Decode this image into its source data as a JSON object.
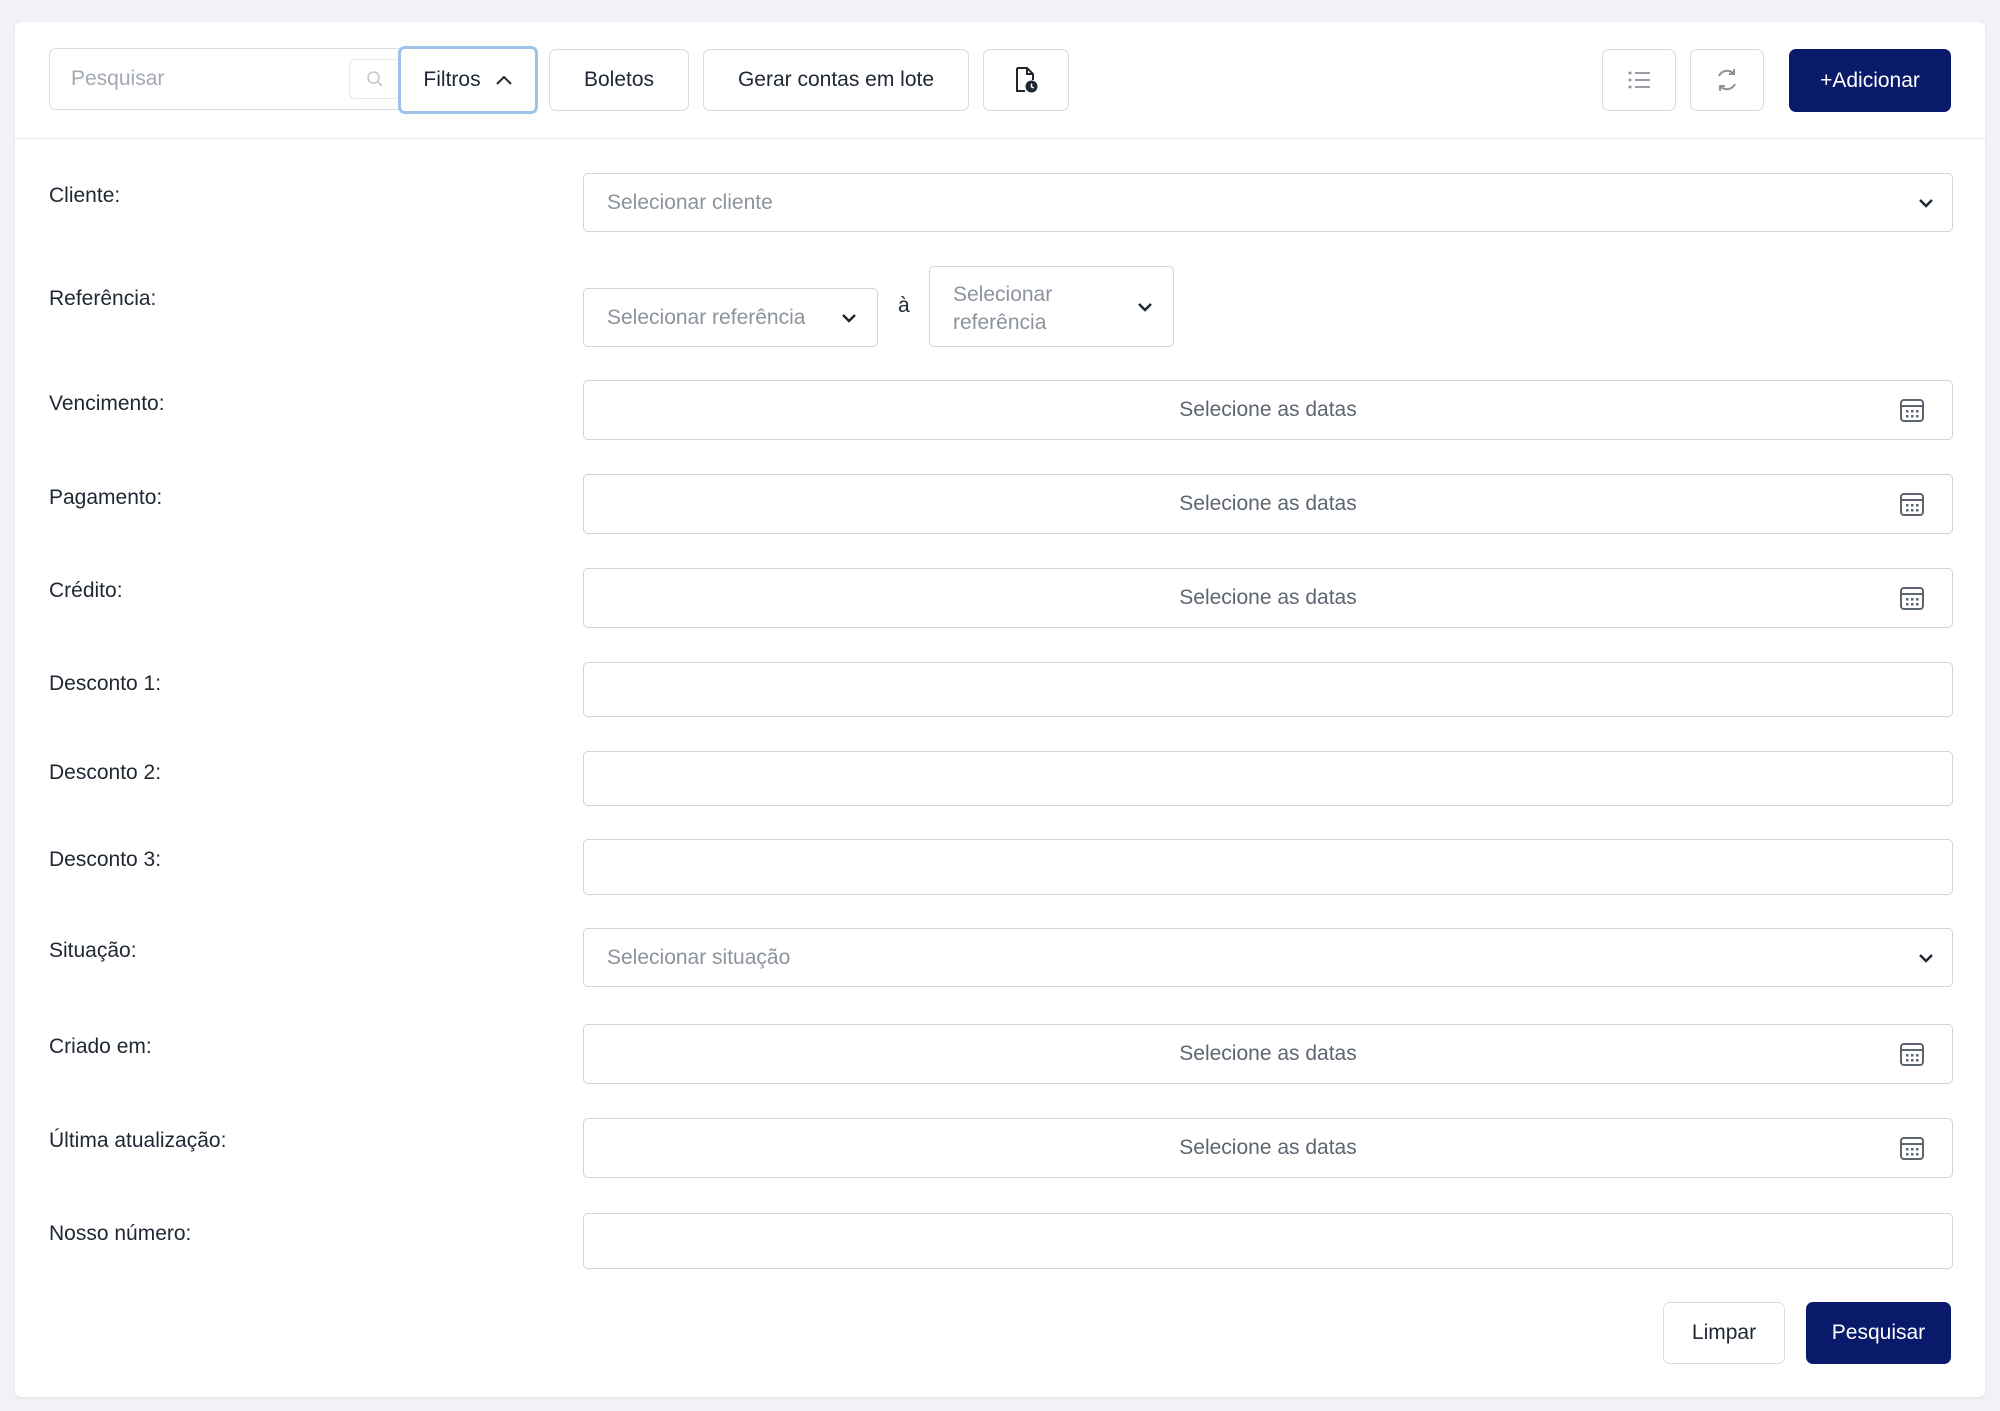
{
  "toolbar": {
    "search_placeholder": "Pesquisar",
    "filters_label": "Filtros",
    "boletos_label": "Boletos",
    "batch_label": "Gerar contas em lote",
    "add_label": "+Adicionar"
  },
  "filters": {
    "cliente": {
      "label": "Cliente:",
      "placeholder": "Selecionar cliente"
    },
    "referencia": {
      "label": "Referência:",
      "from_placeholder": "Selecionar referência",
      "separator": "à",
      "to_placeholder_line1": "Selecionar",
      "to_placeholder_line2": "referência"
    },
    "vencimento": {
      "label": "Vencimento:",
      "placeholder": "Selecione as datas"
    },
    "pagamento": {
      "label": "Pagamento:",
      "placeholder": "Selecione as datas"
    },
    "credito": {
      "label": "Crédito:",
      "placeholder": "Selecione as datas"
    },
    "desconto1": {
      "label": "Desconto 1:",
      "value": ""
    },
    "desconto2": {
      "label": "Desconto 2:",
      "value": ""
    },
    "desconto3": {
      "label": "Desconto 3:",
      "value": ""
    },
    "situacao": {
      "label": "Situação:",
      "placeholder": "Selecionar situação"
    },
    "criado_em": {
      "label": "Criado em:",
      "placeholder": "Selecione as datas"
    },
    "ultima_atualizacao": {
      "label": "Última atualização:",
      "placeholder": "Selecione as datas"
    },
    "nosso_numero": {
      "label": "Nosso número:",
      "value": ""
    }
  },
  "actions": {
    "clear_label": "Limpar",
    "search_label": "Pesquisar"
  },
  "colors": {
    "primary": "#0a1a6a",
    "focus_border": "#9cc3ea"
  },
  "icons": {
    "search": "search-icon",
    "filters_toggle": "chevron-up-icon",
    "document_schedule": "document-clock-icon",
    "list": "list-icon",
    "refresh": "refresh-icon",
    "select": "chevron-down-icon",
    "date": "calendar-icon"
  }
}
